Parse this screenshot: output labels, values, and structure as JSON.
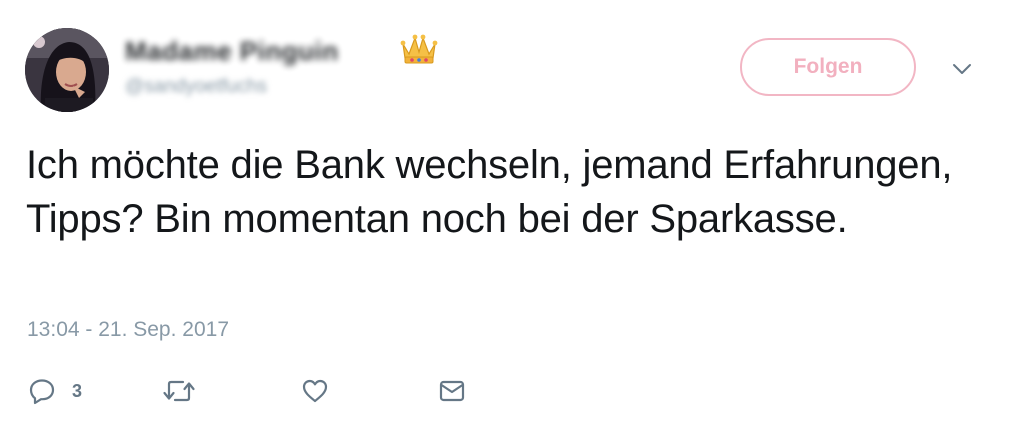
{
  "user": {
    "display_name": "Madame Pinguin",
    "handle": "@sandyoetfuchs",
    "badge_icon": "crown-icon"
  },
  "header": {
    "follow_label": "Folgen",
    "menu_icon": "chevron-down-icon"
  },
  "tweet": {
    "text": "Ich möchte die Bank wechseln, jemand Erfahrungen, Tipps? Bin momentan noch bei der Sparkasse.",
    "timestamp": "13:04 - 21. Sep. 2017"
  },
  "actions": {
    "reply_icon": "reply-icon",
    "reply_count": "3",
    "retweet_icon": "retweet-icon",
    "like_icon": "heart-icon",
    "message_icon": "envelope-icon"
  },
  "colors": {
    "follow_accent": "#f2b6c4",
    "text": "#14171a",
    "muted": "#8899a6",
    "icon": "#657786"
  }
}
